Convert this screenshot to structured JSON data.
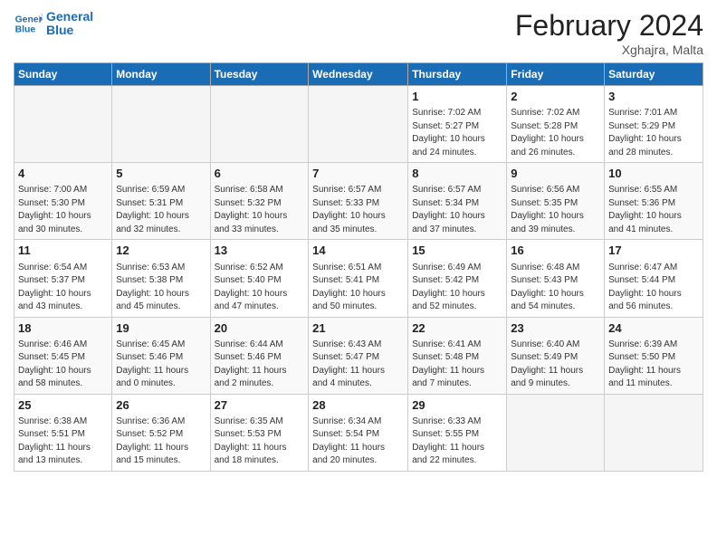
{
  "logo": {
    "line1": "General",
    "line2": "Blue"
  },
  "title": "February 2024",
  "location": "Xghajra, Malta",
  "days_of_week": [
    "Sunday",
    "Monday",
    "Tuesday",
    "Wednesday",
    "Thursday",
    "Friday",
    "Saturday"
  ],
  "weeks": [
    [
      {
        "day": "",
        "info": ""
      },
      {
        "day": "",
        "info": ""
      },
      {
        "day": "",
        "info": ""
      },
      {
        "day": "",
        "info": ""
      },
      {
        "day": "1",
        "info": "Sunrise: 7:02 AM\nSunset: 5:27 PM\nDaylight: 10 hours\nand 24 minutes."
      },
      {
        "day": "2",
        "info": "Sunrise: 7:02 AM\nSunset: 5:28 PM\nDaylight: 10 hours\nand 26 minutes."
      },
      {
        "day": "3",
        "info": "Sunrise: 7:01 AM\nSunset: 5:29 PM\nDaylight: 10 hours\nand 28 minutes."
      }
    ],
    [
      {
        "day": "4",
        "info": "Sunrise: 7:00 AM\nSunset: 5:30 PM\nDaylight: 10 hours\nand 30 minutes."
      },
      {
        "day": "5",
        "info": "Sunrise: 6:59 AM\nSunset: 5:31 PM\nDaylight: 10 hours\nand 32 minutes."
      },
      {
        "day": "6",
        "info": "Sunrise: 6:58 AM\nSunset: 5:32 PM\nDaylight: 10 hours\nand 33 minutes."
      },
      {
        "day": "7",
        "info": "Sunrise: 6:57 AM\nSunset: 5:33 PM\nDaylight: 10 hours\nand 35 minutes."
      },
      {
        "day": "8",
        "info": "Sunrise: 6:57 AM\nSunset: 5:34 PM\nDaylight: 10 hours\nand 37 minutes."
      },
      {
        "day": "9",
        "info": "Sunrise: 6:56 AM\nSunset: 5:35 PM\nDaylight: 10 hours\nand 39 minutes."
      },
      {
        "day": "10",
        "info": "Sunrise: 6:55 AM\nSunset: 5:36 PM\nDaylight: 10 hours\nand 41 minutes."
      }
    ],
    [
      {
        "day": "11",
        "info": "Sunrise: 6:54 AM\nSunset: 5:37 PM\nDaylight: 10 hours\nand 43 minutes."
      },
      {
        "day": "12",
        "info": "Sunrise: 6:53 AM\nSunset: 5:38 PM\nDaylight: 10 hours\nand 45 minutes."
      },
      {
        "day": "13",
        "info": "Sunrise: 6:52 AM\nSunset: 5:40 PM\nDaylight: 10 hours\nand 47 minutes."
      },
      {
        "day": "14",
        "info": "Sunrise: 6:51 AM\nSunset: 5:41 PM\nDaylight: 10 hours\nand 50 minutes."
      },
      {
        "day": "15",
        "info": "Sunrise: 6:49 AM\nSunset: 5:42 PM\nDaylight: 10 hours\nand 52 minutes."
      },
      {
        "day": "16",
        "info": "Sunrise: 6:48 AM\nSunset: 5:43 PM\nDaylight: 10 hours\nand 54 minutes."
      },
      {
        "day": "17",
        "info": "Sunrise: 6:47 AM\nSunset: 5:44 PM\nDaylight: 10 hours\nand 56 minutes."
      }
    ],
    [
      {
        "day": "18",
        "info": "Sunrise: 6:46 AM\nSunset: 5:45 PM\nDaylight: 10 hours\nand 58 minutes."
      },
      {
        "day": "19",
        "info": "Sunrise: 6:45 AM\nSunset: 5:46 PM\nDaylight: 11 hours\nand 0 minutes."
      },
      {
        "day": "20",
        "info": "Sunrise: 6:44 AM\nSunset: 5:46 PM\nDaylight: 11 hours\nand 2 minutes."
      },
      {
        "day": "21",
        "info": "Sunrise: 6:43 AM\nSunset: 5:47 PM\nDaylight: 11 hours\nand 4 minutes."
      },
      {
        "day": "22",
        "info": "Sunrise: 6:41 AM\nSunset: 5:48 PM\nDaylight: 11 hours\nand 7 minutes."
      },
      {
        "day": "23",
        "info": "Sunrise: 6:40 AM\nSunset: 5:49 PM\nDaylight: 11 hours\nand 9 minutes."
      },
      {
        "day": "24",
        "info": "Sunrise: 6:39 AM\nSunset: 5:50 PM\nDaylight: 11 hours\nand 11 minutes."
      }
    ],
    [
      {
        "day": "25",
        "info": "Sunrise: 6:38 AM\nSunset: 5:51 PM\nDaylight: 11 hours\nand 13 minutes."
      },
      {
        "day": "26",
        "info": "Sunrise: 6:36 AM\nSunset: 5:52 PM\nDaylight: 11 hours\nand 15 minutes."
      },
      {
        "day": "27",
        "info": "Sunrise: 6:35 AM\nSunset: 5:53 PM\nDaylight: 11 hours\nand 18 minutes."
      },
      {
        "day": "28",
        "info": "Sunrise: 6:34 AM\nSunset: 5:54 PM\nDaylight: 11 hours\nand 20 minutes."
      },
      {
        "day": "29",
        "info": "Sunrise: 6:33 AM\nSunset: 5:55 PM\nDaylight: 11 hours\nand 22 minutes."
      },
      {
        "day": "",
        "info": ""
      },
      {
        "day": "",
        "info": ""
      }
    ]
  ]
}
